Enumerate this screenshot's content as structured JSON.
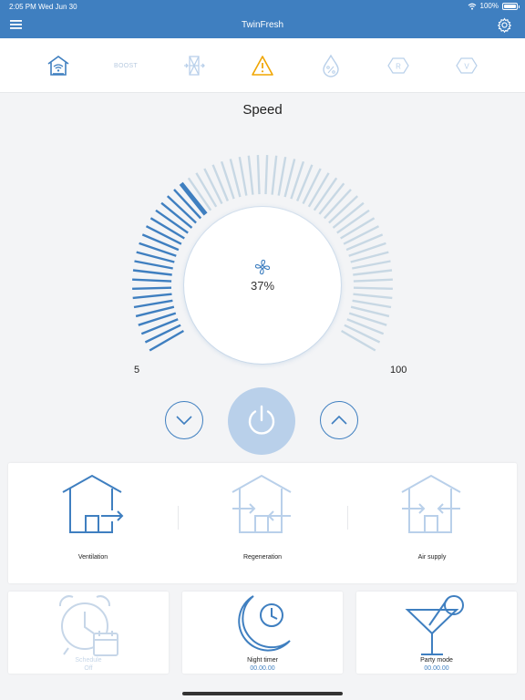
{
  "status": {
    "time": "2:05 PM",
    "date": "Wed Jun 30",
    "battery": "100%",
    "battery_level": 1.0
  },
  "app": {
    "title": "TwinFresh"
  },
  "toolbar": {
    "icons": [
      "home-wifi-icon",
      "boost-icon",
      "filter-icon",
      "warning-icon",
      "humidity-icon",
      "r-badge-icon",
      "v-badge-icon"
    ],
    "boost_label": "BOOST"
  },
  "speed": {
    "title": "Speed",
    "value": 37,
    "value_label": "37%",
    "min_label": "5",
    "max_label": "100",
    "min": 5,
    "max": 100
  },
  "colors": {
    "primary": "#3f7fc0",
    "inactive": "#b9d0ea",
    "tick_inactive": "#c8d8e4",
    "tick_active": "#3f7fc0",
    "warning": "#f0a500"
  },
  "modes": [
    {
      "label": "Ventilation",
      "active": true
    },
    {
      "label": "Regeneration",
      "active": false
    },
    {
      "label": "Air supply",
      "active": false
    }
  ],
  "tiles": {
    "schedule": {
      "label": "Schedule",
      "value": "Off",
      "active": false
    },
    "night_timer": {
      "label": "Night timer",
      "value": "00.00.00",
      "active": true
    },
    "party_mode": {
      "label": "Party mode",
      "value": "00.00.00",
      "active": true
    }
  }
}
